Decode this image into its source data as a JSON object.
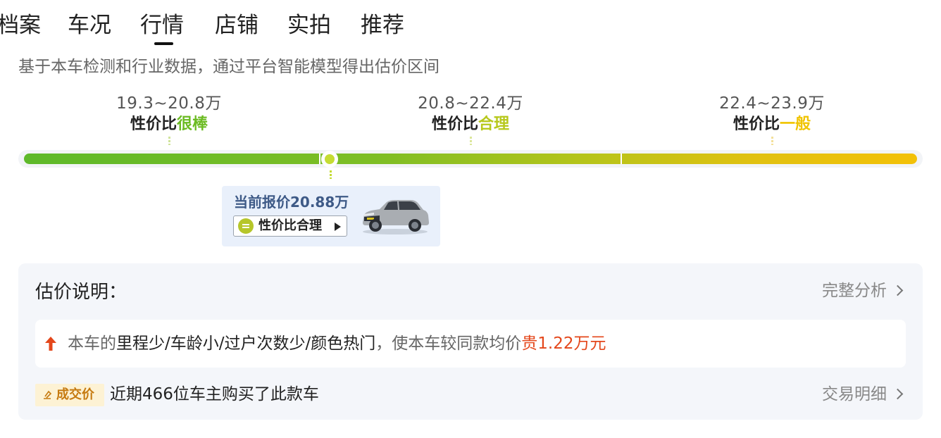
{
  "tabs": [
    {
      "label": "档案"
    },
    {
      "label": "车况"
    },
    {
      "label": "行情",
      "active": true
    },
    {
      "label": "店铺"
    },
    {
      "label": "实拍"
    },
    {
      "label": "推荐"
    }
  ],
  "subtitle": "基于本车检测和行业数据，通过平台智能模型得出估价区间",
  "ranges": [
    {
      "price": "19.3~20.8万",
      "label_prefix": "性价比",
      "label_level": "很棒",
      "color": "#6bbb22"
    },
    {
      "price": "20.8~22.4万",
      "label_prefix": "性价比",
      "label_level": "合理",
      "color": "#b7c81b"
    },
    {
      "price": "22.4~23.9万",
      "label_prefix": "性价比",
      "label_level": "一般",
      "color": "#f0c400"
    }
  ],
  "current_position_fraction": 0.345,
  "current_card": {
    "title": "当前报价20.88万",
    "button_label": "性价比合理",
    "icon": "equals-circle-icon",
    "image": "car-suv-image"
  },
  "explanation": {
    "title": "估价说明：",
    "link_label": "完整分析",
    "reason_prefix": "本车的",
    "reason_factors": "里程少/车龄小/过户次数少/颜色热门",
    "reason_middle": "，使本车较同款均价",
    "reason_result": "贵1.22万元",
    "reason_color": "#e4471b",
    "deal_badge": "成交价",
    "deal_text": "近期466位车主购买了此款车",
    "deal_link_label": "交易明细"
  }
}
